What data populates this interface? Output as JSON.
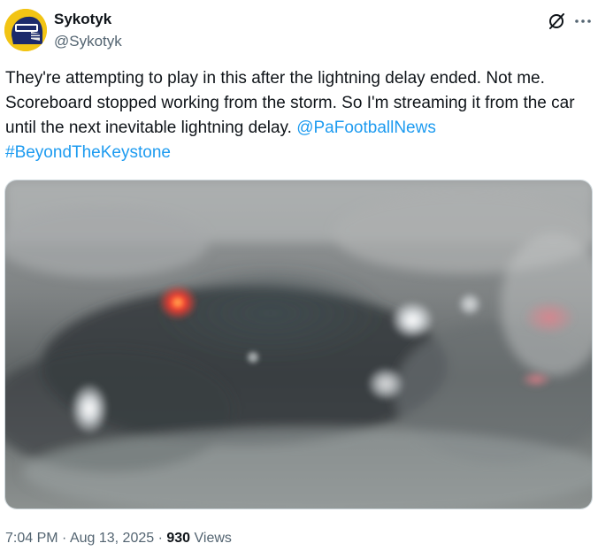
{
  "author": {
    "display_name": "Sykotyk",
    "handle": "@Sykotyk",
    "avatar_icon": "avatar-helmet-icon",
    "avatar_colors": {
      "background": "#f2c414",
      "helmet": "#1c2a6b"
    }
  },
  "header_actions": {
    "grok_icon": "grok-icon",
    "more_icon": "more-dots-icon"
  },
  "tweet": {
    "text_main": "They're attempting to play in this after the lightning delay ended. Not me. Scoreboard stopped working from the storm. So I'm streaming it from the car until the next inevitable lightning delay.",
    "mention": "@PaFootballNews",
    "hashtag": "#BeyondTheKeystone",
    "link_color": "#1d9bf0"
  },
  "media": {
    "type": "photo",
    "description_icon": "rainy-windshield-photo"
  },
  "meta": {
    "time": "7:04 PM",
    "separator": "·",
    "date": "Aug 13, 2025",
    "views_count": "930",
    "views_label": "Views"
  }
}
